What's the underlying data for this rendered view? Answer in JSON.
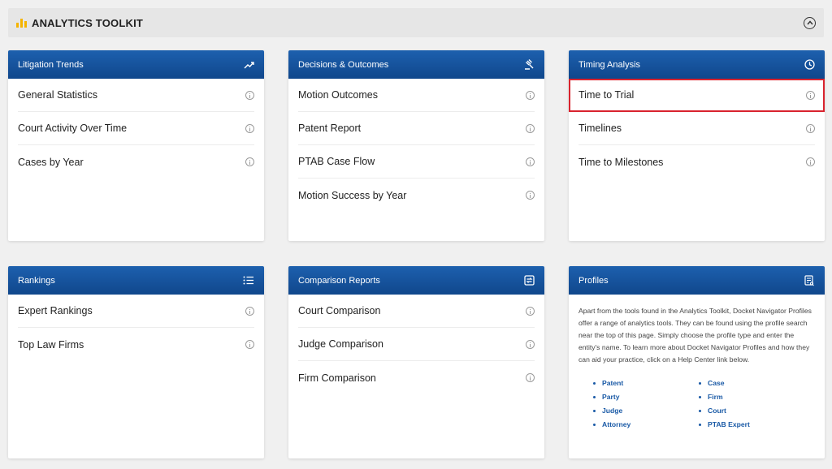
{
  "toolkit": {
    "title": "ANALYTICS TOOLKIT",
    "accent_color": "#f5b400",
    "collapse_icon": "chevron-up-circle-icon"
  },
  "colors": {
    "card_header": "#1356a0",
    "highlight": "#d9232e",
    "link": "#1a5aa6"
  },
  "cards": {
    "litigation_trends": {
      "title": "Litigation Trends",
      "icon": "trending-up-icon",
      "items": [
        "General Statistics",
        "Court Activity Over Time",
        "Cases by Year"
      ]
    },
    "decisions_outcomes": {
      "title": "Decisions & Outcomes",
      "icon": "gavel-icon",
      "items": [
        "Motion Outcomes",
        "Patent Report",
        "PTAB Case Flow",
        "Motion Success by Year"
      ]
    },
    "timing_analysis": {
      "title": "Timing Analysis",
      "icon": "clock-icon",
      "items": [
        "Time to Trial",
        "Timelines",
        "Time to Milestones"
      ]
    },
    "rankings": {
      "title": "Rankings",
      "icon": "list-icon",
      "items": [
        "Expert Rankings",
        "Top Law Firms"
      ]
    },
    "comparison_reports": {
      "title": "Comparison Reports",
      "icon": "compare-icon",
      "items": [
        "Court Comparison",
        "Judge Comparison",
        "Firm Comparison"
      ]
    },
    "profiles": {
      "title": "Profiles",
      "icon": "profile-document-icon",
      "description": "Apart from the tools found in the Analytics Toolkit, Docket Navigator Profiles offer a range of analytics tools. They can be found using the profile search near the top of this page. Simply choose the profile type and enter the entity's name. To learn more about Docket Navigator Profiles and how they can aid your practice, click on a Help Center link below.",
      "links": [
        "Patent",
        "Case",
        "Party",
        "Firm",
        "Judge",
        "Court",
        "Attorney",
        "PTAB Expert"
      ]
    }
  }
}
